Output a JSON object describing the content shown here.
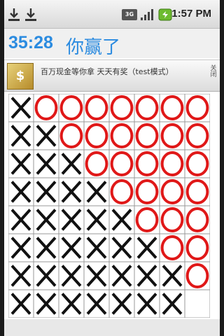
{
  "status_bar": {
    "time": "1:57 PM",
    "network_label": "3G",
    "icons": [
      "download-icon",
      "download-icon",
      "3g-icon",
      "signal-icon",
      "battery-icon"
    ]
  },
  "header": {
    "timer": "35:28",
    "result_text": "你赢了"
  },
  "ad": {
    "logo_text": "$",
    "text": "百万现金等你拿   天天有奖（test模式）",
    "close_label": "关闭"
  },
  "board": {
    "cols": 8,
    "rows": 8,
    "cells": [
      "XOOOOOOO",
      "XXOOOOOO",
      "XXXOOOOO",
      "XXXXOOOO",
      "XXXXXOOO",
      "XXXXXXOO",
      "XXXXXXXO",
      "XXXXXXX."
    ],
    "colors": {
      "x": "#111111",
      "o": "#e01818",
      "grid": "#9a9a9a"
    }
  },
  "colors": {
    "accent": "#2b8be0"
  }
}
